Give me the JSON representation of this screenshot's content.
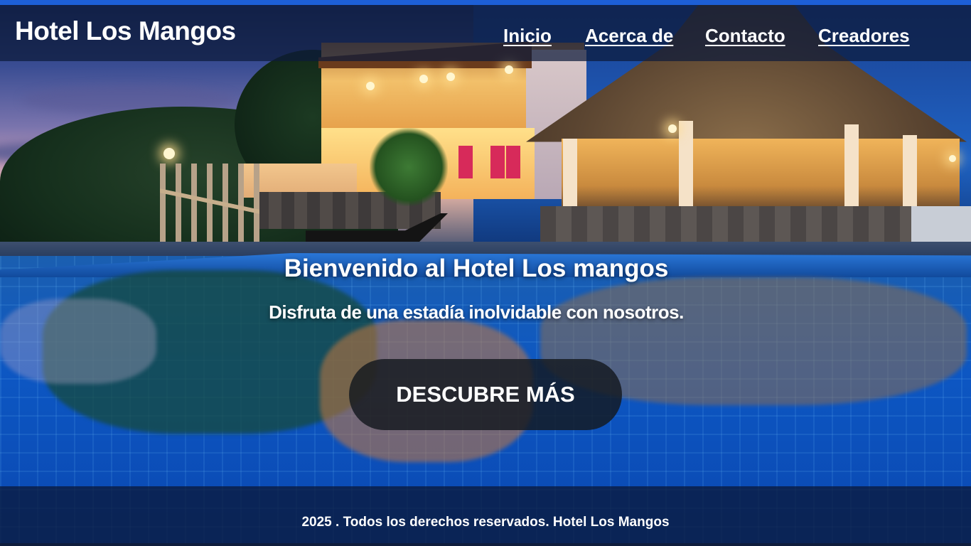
{
  "header": {
    "brand": "Hotel Los Mangos",
    "nav": [
      {
        "label": "Inicio"
      },
      {
        "label": "Acerca de"
      },
      {
        "label": "Contacto"
      },
      {
        "label": "Creadores"
      }
    ]
  },
  "hero": {
    "title": "Bienvenido al Hotel Los mangos",
    "subtitle": "Disfruta de una estadía inolvidable con nosotros.",
    "cta_label": "DESCUBRE MÁS",
    "background_image": "hotel-pool-photo"
  },
  "footer": {
    "text": "2025 . Todos los derechos reservados.  Hotel  Los Mangos"
  },
  "colors": {
    "top_strip": "#1d5fd6",
    "header_bg": "#0c1a3a",
    "text": "#ffffff",
    "cta_bg": "#14181e"
  }
}
